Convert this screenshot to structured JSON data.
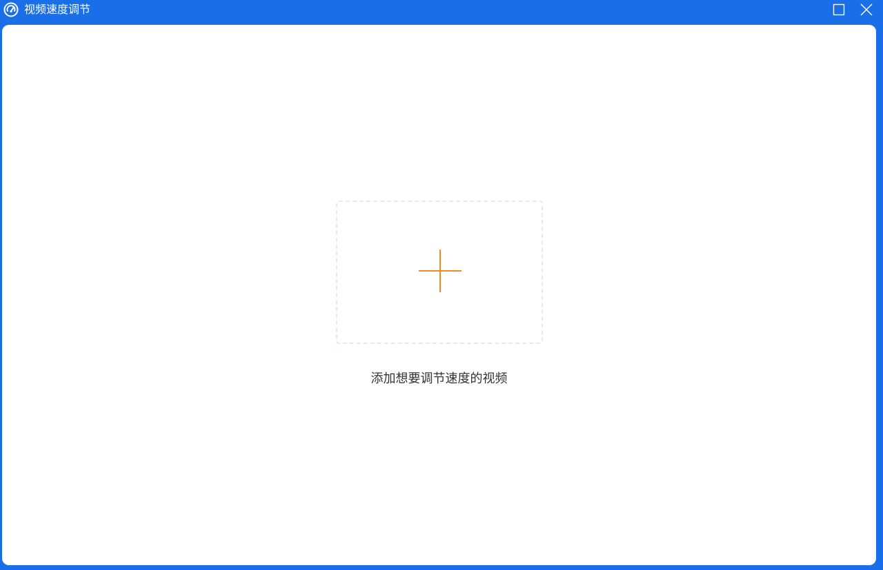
{
  "window": {
    "title": "视频速度调节",
    "icon": "speedometer-icon",
    "controls": [
      "maximize-icon",
      "close-icon"
    ]
  },
  "main": {
    "drop_zone_icon": "plus-icon",
    "hint": "添加想要调节速度的视频"
  },
  "colors": {
    "titlebar": "#1a6ee8",
    "background": "#ffffff",
    "accent_plus": "#f08a24",
    "dashed_border": "#deebf8",
    "hint_text": "#333333"
  }
}
